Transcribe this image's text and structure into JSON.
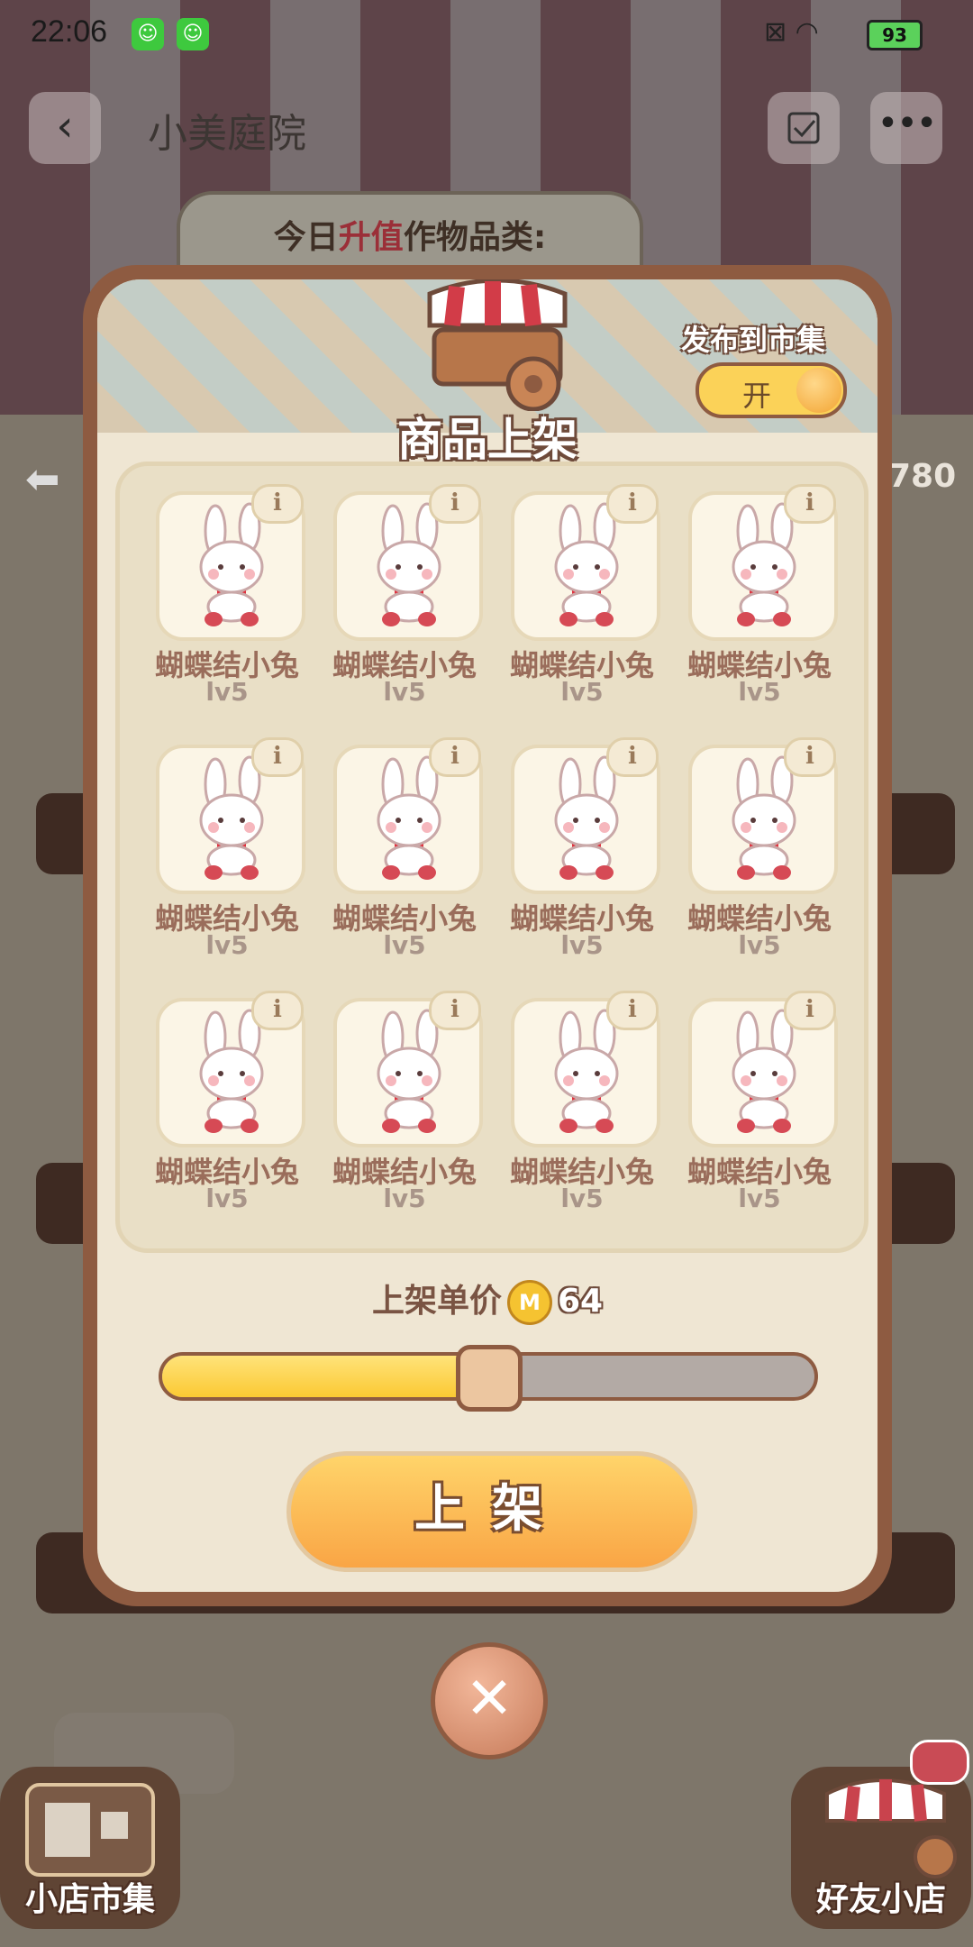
{
  "status_bar": {
    "time": "22:06",
    "battery": "93"
  },
  "header": {
    "title": "小美庭院",
    "back_icon": "‹",
    "more_icon": "•••"
  },
  "background": {
    "today_label_prefix": "今日",
    "today_label_highlight": "升值",
    "today_label_suffix": "作物品类:",
    "count_partial": "780"
  },
  "dialog": {
    "title": "商品上架",
    "publish": {
      "label": "发布到市集",
      "toggle_text": "开",
      "enabled": true
    },
    "items": [
      {
        "name": "蝴蝶结小兔",
        "level": "lv5"
      },
      {
        "name": "蝴蝶结小兔",
        "level": "lv5"
      },
      {
        "name": "蝴蝶结小兔",
        "level": "lv5"
      },
      {
        "name": "蝴蝶结小兔",
        "level": "lv5"
      },
      {
        "name": "蝴蝶结小兔",
        "level": "lv5"
      },
      {
        "name": "蝴蝶结小兔",
        "level": "lv5"
      },
      {
        "name": "蝴蝶结小兔",
        "level": "lv5"
      },
      {
        "name": "蝴蝶结小兔",
        "level": "lv5"
      },
      {
        "name": "蝴蝶结小兔",
        "level": "lv5"
      },
      {
        "name": "蝴蝶结小兔",
        "level": "lv5"
      },
      {
        "name": "蝴蝶结小兔",
        "level": "lv5"
      },
      {
        "name": "蝴蝶结小兔",
        "level": "lv5"
      }
    ],
    "info_icon": "i",
    "price": {
      "label": "上架单价",
      "coin_symbol": "M",
      "value": "64",
      "slider_fraction": 0.5
    },
    "submit_label": "上架",
    "close_icon": "✕"
  },
  "bottom": {
    "left_label": "小店市集",
    "right_label": "好友小店"
  },
  "colors": {
    "accent": "#f9a545",
    "frame": "#8e5b41",
    "text_brown": "#9a6d5b"
  }
}
